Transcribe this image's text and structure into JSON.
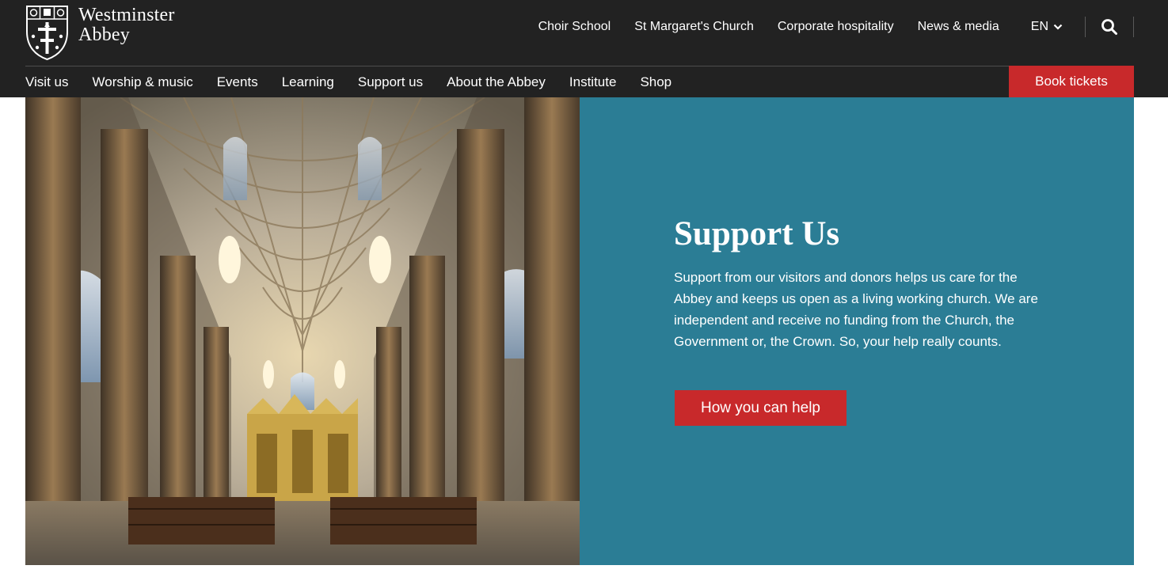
{
  "brand": {
    "logo_line1": "Westminster",
    "logo_line2": "Abbey"
  },
  "utility_nav": [
    {
      "label": "Choir School"
    },
    {
      "label": "St Margaret's Church"
    },
    {
      "label": "Corporate hospitality"
    },
    {
      "label": "News & media"
    }
  ],
  "language": {
    "label": "EN",
    "icon": "chevron-down-icon"
  },
  "search": {
    "icon": "search-icon"
  },
  "main_nav": [
    {
      "label": "Visit us"
    },
    {
      "label": "Worship & music"
    },
    {
      "label": "Events"
    },
    {
      "label": "Learning"
    },
    {
      "label": "Support us"
    },
    {
      "label": "About the Abbey"
    },
    {
      "label": "Institute"
    },
    {
      "label": "Shop"
    }
  ],
  "book_button": {
    "label": "Book tickets"
  },
  "hero": {
    "image_alt": "Westminster Abbey nave interior",
    "title": "Support Us",
    "body": "Support from our visitors and donors helps us care for the Abbey and keeps us open as a living working church. We are independent and receive no funding from the Church, the Government or, the Crown. So, your help really counts.",
    "cta_label": "How you can help"
  },
  "colors": {
    "header_bg": "#222222",
    "accent_red": "#c8292b",
    "panel_teal": "#2b7d95"
  }
}
